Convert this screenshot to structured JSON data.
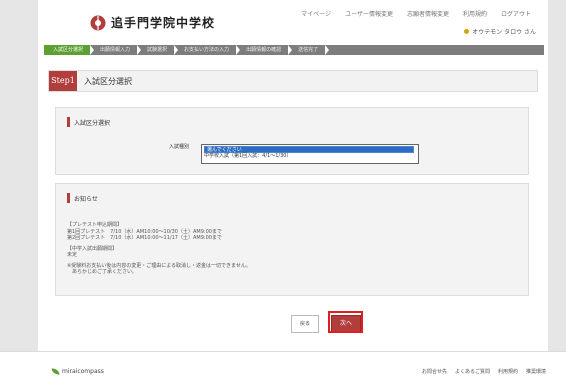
{
  "header": {
    "school_name": "追手門学院中学校",
    "nav": [
      "マイページ",
      "ユーザー情報変更",
      "志願者情報変更",
      "利用規約",
      "ログアウト"
    ],
    "user_name": "オウテモン タロウ さん"
  },
  "steps": [
    "入試区分選択",
    "出願情報入力",
    "試験選択",
    "お支払い方法の入力",
    "出願情報の確認",
    "送信完了"
  ],
  "step_header": {
    "badge": "Step1",
    "title": "入試区分選択"
  },
  "section_select": {
    "title": "入試区分選択",
    "field_label": "入試種別",
    "options": [
      "選んでください",
      "中学校入試（第1回入試：4/1〜1/30）"
    ],
    "selected_index": 0
  },
  "section_news": {
    "title": "お知らせ",
    "lines": [
      "【プレテスト申込期間】",
      "第1回プレテスト　7/10（水）AM10:00〜10/30（土）AM9:00まで",
      "第2回プレテスト　7/10（水）AM10:00〜11/17（土）AM9:00まで",
      "",
      "【中学入試出願期間】",
      "未定",
      "",
      "※受験料お支払い後は内容の変更・ご理由による取消し・返金は一切できません。",
      "　あらかじめご了承ください。"
    ]
  },
  "buttons": {
    "back": "戻る",
    "next": "次へ"
  },
  "footer": {
    "logo_text": "miraicompass",
    "links": [
      "お問合せ先",
      "よくあるご質問",
      "利用規約",
      "推奨環境"
    ]
  },
  "colors": {
    "accent": "#b13d3d",
    "active_step": "#5da032",
    "highlight": "#e02020"
  }
}
